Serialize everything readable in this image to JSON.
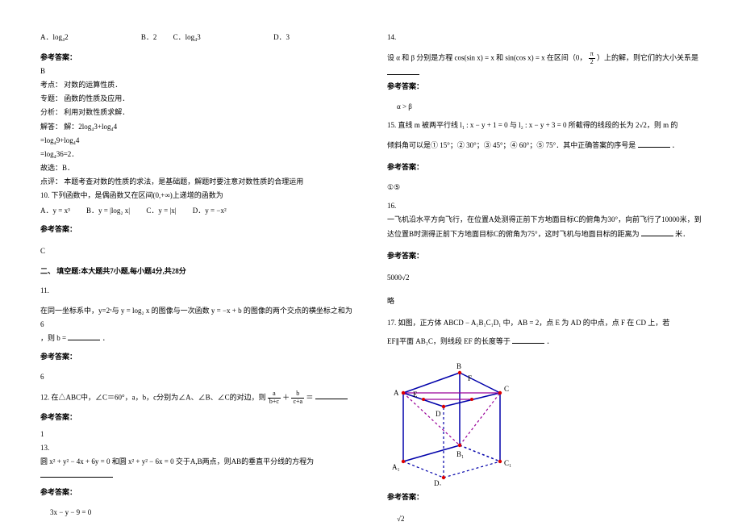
{
  "col1": {
    "q9_optA": "A．log₄2",
    "q9_optB": "B．2",
    "q9_optC": "C．log₄3",
    "q9_optD": "D．3",
    "ans_label": "参考答案：",
    "q9_ans": "B",
    "kaodian_label": "考点：",
    "kaodian": "对数的运算性质．",
    "zhuanti_label": "专题：",
    "zhuanti": "函数的性质及应用．",
    "fenxi_label": "分析：",
    "fenxi": "利用对数性质求解．",
    "jieda_label": "解答：",
    "jieda1": "解：2log₄3+log₄4",
    "jieda2": "=log₄9+log₄4",
    "jieda3": "=log₄36=2．",
    "jieda4": "故选：B．",
    "dianping_label": "点评：",
    "dianping": "本题考查对数的性质的求法，是基础题，解题时要注意对数性质的合理运用",
    "q10_stem": "10. 下列函数中，是偶函数又在区间(0,+∞)上递增的函数为",
    "q10_A": "A．y = x³",
    "q10_B": "B．y = |log₂ x|",
    "q10_C": "C．y = |x|",
    "q10_D": "D．y = −x²",
    "q10_ans": "C",
    "section2": "二、 填空题:本大题共7小题,每小题4分,共28分",
    "q11_num": "11.",
    "q11_stem1": "在同一坐标系中，y=2ˣ与 y = log₂ x 的图像与一次函数 y = −x + b 的图像的两个交点的横坐标之和为6",
    "q11_stem2": "，则 b = ",
    "q11_period": "．",
    "q11_ans": "6",
    "q12_stem_a": "12. 在△ABC中，∠C＝60°，a，b，c分别为∠A、∠B、∠C的对边，则",
    "q12_frac1_top": "a",
    "q12_frac1_bot": "b+c",
    "q12_plus": "＋",
    "q12_frac2_top": "b",
    "q12_frac2_bot": "c+a",
    "q12_eq": "＝",
    "q12_ans": "1",
    "q13_num": "13.",
    "q13_stem": "圆 x² + y² − 4x + 6y = 0 和圆 x² + y² − 6x = 0 交于A,B两点，则AB的垂直平分线的方程为",
    "q13_ans": "3x − y − 9 = 0"
  },
  "col2": {
    "q14_num": "14.",
    "q14_stem_a": "设 α 和 β 分别是方程 cos(sin x) = x 和 sin(cos x) = x 在区间（0，",
    "q14_pi2_top": "π",
    "q14_pi2_bot": "2",
    "q14_stem_b": "）上的解，则它们的大小关系是",
    "ans_label": "参考答案：",
    "q14_ans": "α > β",
    "q15_stem_a": "15. 直线 m 被两平行线 l₁ : x − y + 1 = 0 与 l₂ : x − y + 3 = 0 所截得的线段的长为 2√2，则 m 的",
    "q15_stem_b": "倾斜角可以是① 15°；② 30°；③ 45°；④ 60°；⑤ 75°．其中正确答案的序号是",
    "q15_period": "．",
    "q15_ans": "①⑤",
    "q16_num": "16.",
    "q16_stem_a": "一飞机沿水平方向飞行，在位置A处测得正前下方地面目标C的俯角为30°，向前飞行了10000米，到达位置B时测得正前下方地面目标C的俯角为75°，这时飞机与地面目标的距离为",
    "q16_stem_b": "米．",
    "q16_ans": "5000√2",
    "q16_note": "略",
    "q17_stem_a": "17. 如图，正方体 ABCD − A₁B₁C₁D₁ 中，AB = 2，点 E 为 AD 的中点，点 F 在 CD 上，若",
    "q17_stem_b": "EF∥平面 AB₁C，则线段 EF 的长度等于",
    "q17_period": "．",
    "q17_cube": {
      "A": "A",
      "B": "B",
      "C": "C",
      "D": "D",
      "E": "E",
      "F": "F",
      "A1": "A₁",
      "B1": "B₁",
      "C1": "C₁",
      "D1": "D₁"
    },
    "q17_ans": "√2"
  }
}
